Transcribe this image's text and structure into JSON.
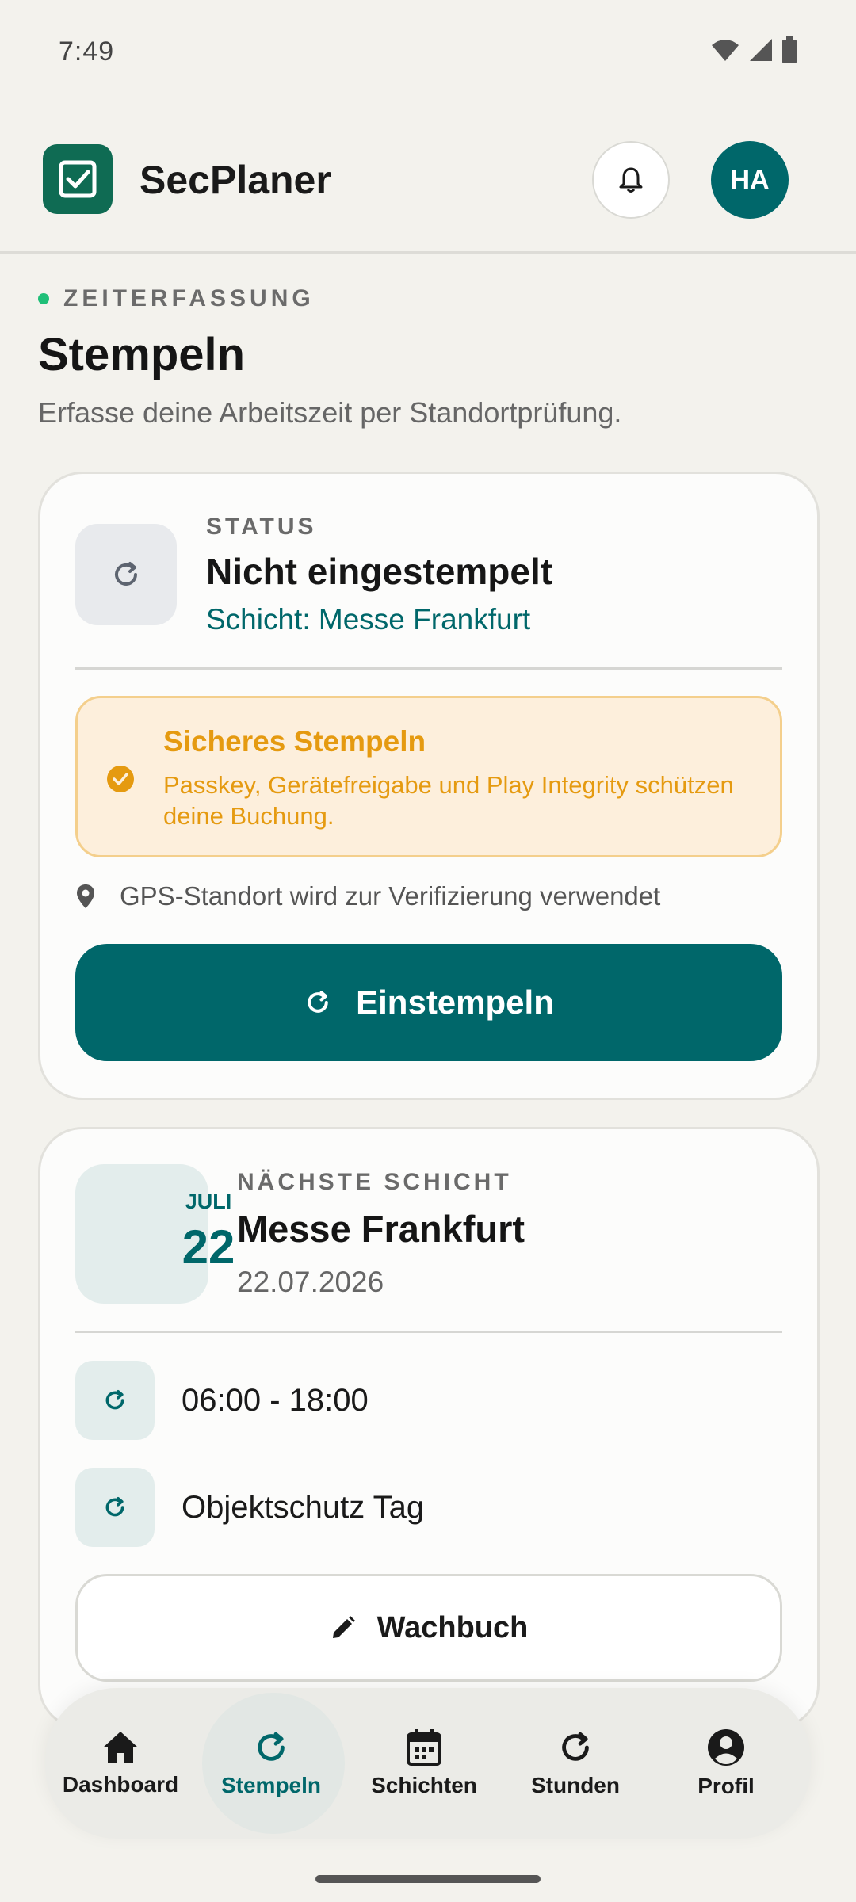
{
  "status_bar": {
    "time": "7:49"
  },
  "app_bar": {
    "title": "SecPlaner",
    "avatar_initials": "HA"
  },
  "header": {
    "eyebrow": "ZEITERFASSUNG",
    "title": "Stempeln",
    "subtitle": "Erfasse deine Arbeitszeit per Standortprüfung."
  },
  "status_card": {
    "label": "STATUS",
    "value": "Nicht eingestempelt",
    "shift": "Schicht: Messe Frankfurt",
    "warning_title": "Sicheres Stempeln",
    "warning_text": "Passkey, Gerätefreigabe und Play Integrity schützen deine Buchung.",
    "gps_text": "GPS-Standort wird zur Verifizierung verwendet",
    "button_label": "Einstempeln"
  },
  "shift_card": {
    "month": "JULI",
    "day": "22",
    "label": "NÄCHSTE SCHICHT",
    "name": "Messe Frankfurt",
    "date": "22.07.2026",
    "time": "06:00 - 18:00",
    "type": "Objektschutz Tag",
    "button_label": "Wachbuch"
  },
  "bottom_nav": {
    "items": [
      {
        "label": "Dashboard",
        "icon": "home-icon"
      },
      {
        "label": "Stempeln",
        "icon": "refresh-icon",
        "active": true
      },
      {
        "label": "Schichten",
        "icon": "calendar-icon"
      },
      {
        "label": "Stunden",
        "icon": "refresh-icon"
      },
      {
        "label": "Profil",
        "icon": "person-icon"
      }
    ]
  },
  "colors": {
    "primary": "#00676a",
    "brand_green": "#0f6b53",
    "warning": "#e59a10",
    "background": "#f3f2ed"
  }
}
